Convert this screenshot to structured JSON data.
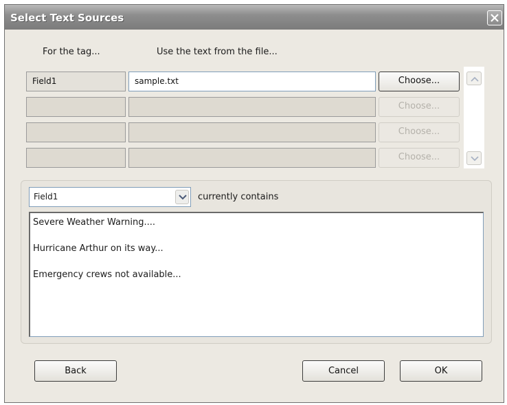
{
  "window": {
    "title": "Select Text Sources"
  },
  "headers": {
    "tag_col": "For the tag...",
    "file_col": "Use the text from the file..."
  },
  "rows": [
    {
      "tag": "Field1",
      "file": "sample.txt",
      "choose": "Choose...",
      "enabled": true
    },
    {
      "tag": "",
      "file": "",
      "choose": "Choose...",
      "enabled": false
    },
    {
      "tag": "",
      "file": "",
      "choose": "Choose...",
      "enabled": false
    },
    {
      "tag": "",
      "file": "",
      "choose": "Choose...",
      "enabled": false
    }
  ],
  "contents": {
    "selected_field": "Field1",
    "label": "currently contains",
    "lines": [
      "Severe Weather Warning....",
      "Hurricane Arthur on its way...",
      "Emergency crews not available..."
    ]
  },
  "buttons": {
    "back": "Back",
    "cancel": "Cancel",
    "ok": "OK"
  }
}
